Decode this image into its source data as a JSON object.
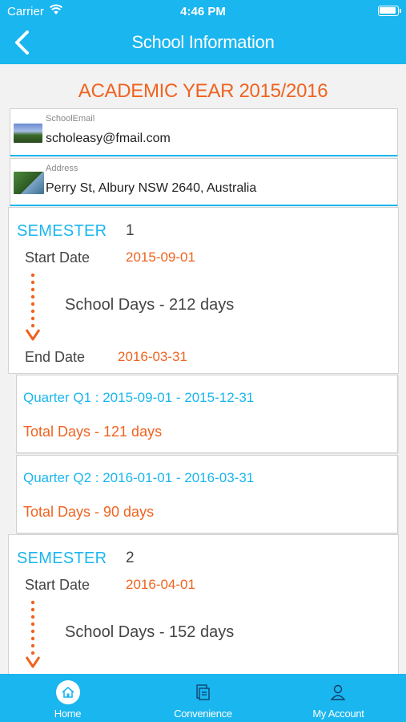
{
  "status_bar": {
    "carrier": "Carrier",
    "time": "4:46 PM"
  },
  "header": {
    "title": "School Information",
    "back_icon": "chevron-left-icon"
  },
  "academic_year": "ACADEMIC YEAR 2015/2016",
  "school_email": {
    "label": "SchoolEmail",
    "value": "scholeasy@fmail.com",
    "image": "mountains-thumbnail"
  },
  "address": {
    "label": "Address",
    "value": "Perry St, Albury NSW 2640, Australia",
    "image": "car-thumbnail"
  },
  "semesters": [
    {
      "label": "SEMESTER",
      "number": "1",
      "start_label": "Start Date",
      "start_date": "2015-09-01",
      "school_days": "School Days - 212 days",
      "end_label": "End Date",
      "end_date": "2016-03-31",
      "quarters": [
        {
          "range": "Quarter Q1 : 2015-09-01 - 2015-12-31",
          "total": "Total Days - 121 days"
        },
        {
          "range": "Quarter Q2 : 2016-01-01 - 2016-03-31",
          "total": "Total Days - 90 days"
        }
      ]
    },
    {
      "label": "SEMESTER",
      "number": "2",
      "start_label": "Start Date",
      "start_date": "2016-04-01",
      "school_days": "School Days - 152 days"
    }
  ],
  "tabs": [
    {
      "label": "Home",
      "icon": "home-icon",
      "active": true
    },
    {
      "label": "Convenience",
      "icon": "document-icon",
      "active": false
    },
    {
      "label": "My Account",
      "icon": "user-icon",
      "active": false
    }
  ],
  "colors": {
    "accent": "#1ab6ef",
    "orange": "#ef6320",
    "text": "#444444"
  }
}
